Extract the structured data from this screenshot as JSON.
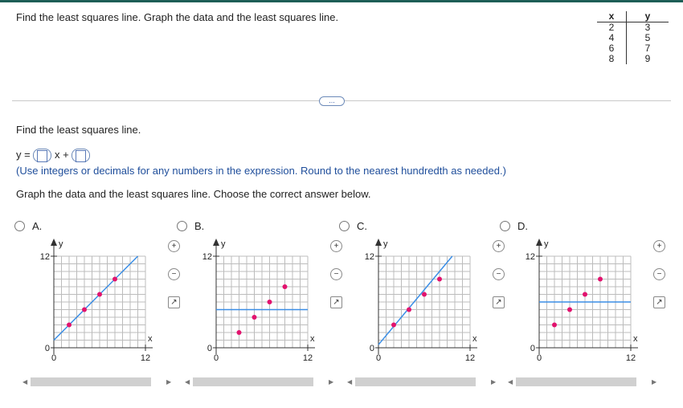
{
  "question": {
    "prompt": "Find the least squares line. Graph the data and the least squares line.",
    "part1": "Find the least squares line.",
    "eq_lhs": "y =",
    "eq_mid": "x +",
    "instruction": "(Use integers or decimals for any numbers in the expression. Round to the nearest hundredth as needed.)",
    "part2": "Graph the data and the least squares line. Choose the correct answer below.",
    "more_button": "..."
  },
  "table": {
    "headers": [
      "x",
      "y"
    ],
    "rows": [
      [
        "2",
        "3"
      ],
      [
        "4",
        "5"
      ],
      [
        "6",
        "7"
      ],
      [
        "8",
        "9"
      ]
    ]
  },
  "options": [
    {
      "letter": "A.",
      "ylabel": "y",
      "xlabel": "x",
      "ytick": "12",
      "yzero": "0",
      "xzero": "0",
      "xtick": "12",
      "points": [
        [
          2,
          3
        ],
        [
          4,
          5
        ],
        [
          6,
          7
        ],
        [
          8,
          9
        ]
      ],
      "line": {
        "type": "slope",
        "m": 1,
        "b": 1
      }
    },
    {
      "letter": "B.",
      "ylabel": "y",
      "xlabel": "x",
      "ytick": "12",
      "yzero": "0",
      "xzero": "0",
      "xtick": "12",
      "points": [
        [
          3,
          2
        ],
        [
          5,
          4
        ],
        [
          7,
          6
        ],
        [
          9,
          8
        ]
      ],
      "line": {
        "type": "horizontal",
        "y": 5
      }
    },
    {
      "letter": "C.",
      "ylabel": "y",
      "xlabel": "x",
      "ytick": "12",
      "yzero": "0",
      "xzero": "0",
      "xtick": "12",
      "points": [
        [
          2,
          3
        ],
        [
          4,
          5
        ],
        [
          6,
          7
        ],
        [
          8,
          9
        ]
      ],
      "line": {
        "type": "slope",
        "m": 1.2,
        "b": 0.4
      }
    },
    {
      "letter": "D.",
      "ylabel": "y",
      "xlabel": "x",
      "ytick": "12",
      "yzero": "0",
      "xzero": "0",
      "xtick": "12",
      "points": [
        [
          2,
          3
        ],
        [
          4,
          5
        ],
        [
          6,
          7
        ],
        [
          8,
          9
        ]
      ],
      "line": {
        "type": "horizontal",
        "y": 6
      }
    }
  ],
  "tools": {
    "zoom_in": "+",
    "zoom_out": "−",
    "popout": "↗"
  },
  "colors": {
    "line": "#3a8ee6",
    "point": "#e2136e",
    "grid": "#bcbcbc",
    "accent": "#1d5e57"
  }
}
